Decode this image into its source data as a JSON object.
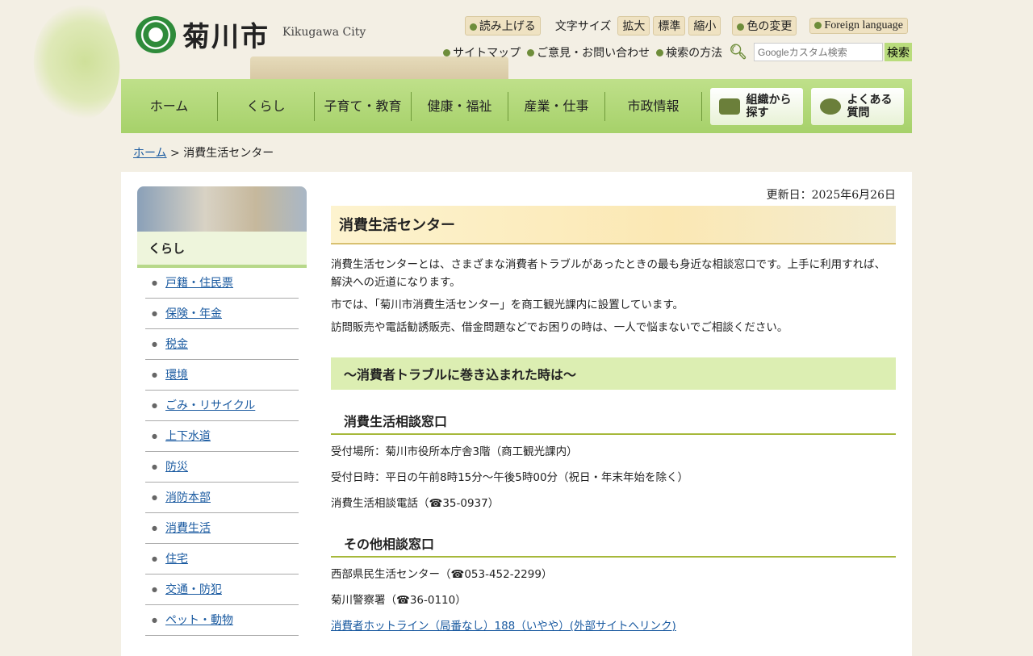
{
  "header": {
    "logo_text": "菊川市",
    "logo_sub": "Kikugawa City",
    "read_aloud": "読み上げる",
    "font_size_label": "文字サイズ",
    "font_large": "拡大",
    "font_normal": "標準",
    "font_small": "縮小",
    "color_change": "色の変更",
    "foreign": "Foreign language",
    "sitemap": "サイトマップ",
    "contact": "ご意見・お問い合わせ",
    "search_help": "検索の方法",
    "search_placeholder": "Googleカスタム検索",
    "search_button": "検索"
  },
  "nav": {
    "items": [
      "ホーム",
      "くらし",
      "子育て・教育",
      "健康・福祉",
      "産業・仕事",
      "市政情報"
    ],
    "org": "組織から探す",
    "faq": "よくある質問"
  },
  "breadcrumb": {
    "home": "ホーム",
    "sep": " > ",
    "current": "消費生活センター"
  },
  "sidebar": {
    "title": "くらし",
    "items": [
      "戸籍・住民票",
      "保険・年金",
      "税金",
      "環境",
      "ごみ・リサイクル",
      "上下水道",
      "防災",
      "消防本部",
      "消費生活",
      "住宅",
      "交通・防犯",
      "ペット・動物"
    ]
  },
  "main": {
    "updated": "更新日：2025年6月26日",
    "title": "消費生活センター",
    "intro": [
      "消費生活センターとは、さまざまな消費者トラブルがあったときの最も身近な相談窓口です。上手に利用すれば、解決への近道になります。",
      "市では、「菊川市消費生活センター」を商工観光課内に設置しています。",
      "訪問販売や電話勧誘販売、借金問題などでお困りの時は、一人で悩まないでご相談ください。"
    ],
    "h2": "～消費者トラブルに巻き込まれた時は～",
    "sec1": {
      "title": "消費生活相談窓口",
      "lines": [
        "受付場所：菊川市役所本庁舎3階（商工観光課内）",
        "受付日時：平日の午前8時15分～午後5時00分（祝日・年末年始を除く）",
        "消費生活相談電話（☎35-0937）"
      ]
    },
    "sec2": {
      "title": "その他相談窓口",
      "lines": [
        "西部県民生活センター（☎053-452-2299）",
        "菊川警察署（☎36-0110）"
      ],
      "link": "消費者ホットライン（局番なし）188（いやや）(外部サイトへリンク)"
    }
  }
}
